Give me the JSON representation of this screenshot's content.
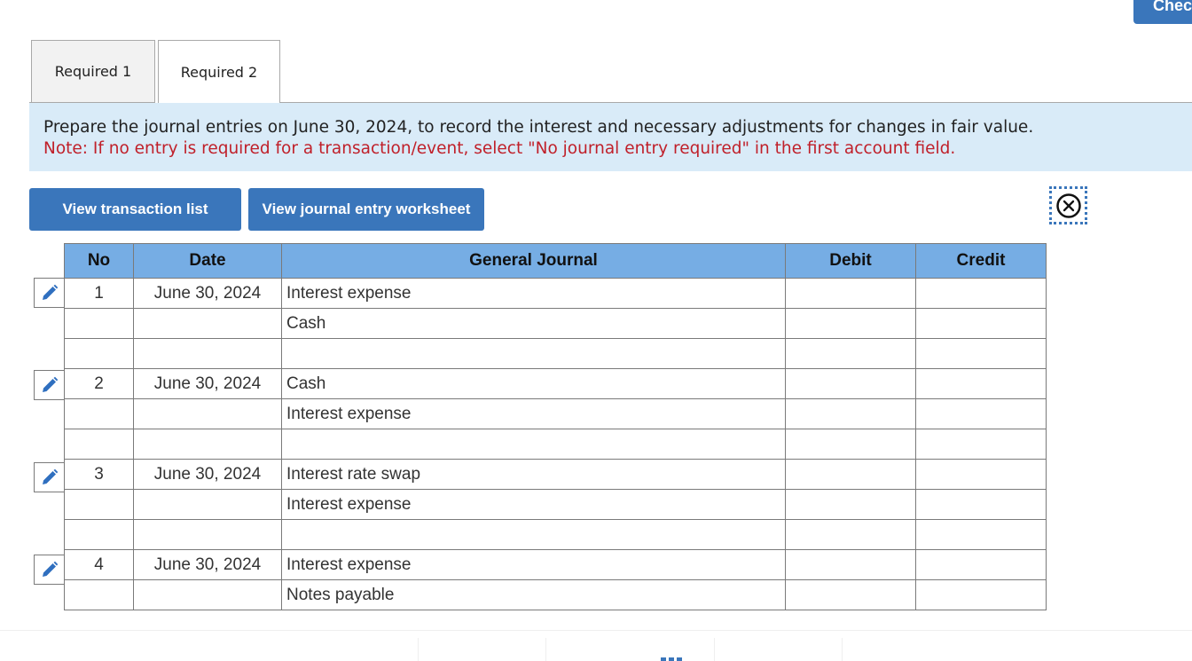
{
  "header": {
    "check_label": "Check"
  },
  "tabs": [
    {
      "label": "Required 1",
      "active": false
    },
    {
      "label": "Required 2",
      "active": true
    }
  ],
  "instructions": {
    "main": "Prepare the journal entries on June 30, 2024, to record the interest and necessary adjustments for changes in fair value.",
    "note": "Note: If no entry is required for a transaction/event, select \"No journal entry required\" in the first account field."
  },
  "buttons": {
    "view_transaction_list": "View transaction list",
    "view_journal_entry_worksheet": "View journal entry worksheet"
  },
  "table": {
    "headers": {
      "no": "No",
      "date": "Date",
      "general_journal": "General Journal",
      "debit": "Debit",
      "credit": "Credit"
    },
    "rows": [
      {
        "no": "1",
        "date": "June 30, 2024",
        "account": "Interest expense",
        "debit": "",
        "credit": ""
      },
      {
        "no": "",
        "date": "",
        "account": "Cash",
        "debit": "",
        "credit": ""
      },
      {
        "no": "",
        "date": "",
        "account": "",
        "debit": "",
        "credit": ""
      },
      {
        "no": "2",
        "date": "June 30, 2024",
        "account": "Cash",
        "debit": "",
        "credit": ""
      },
      {
        "no": "",
        "date": "",
        "account": "Interest expense",
        "debit": "",
        "credit": ""
      },
      {
        "no": "",
        "date": "",
        "account": "",
        "debit": "",
        "credit": ""
      },
      {
        "no": "3",
        "date": "June 30, 2024",
        "account": "Interest rate swap",
        "debit": "",
        "credit": ""
      },
      {
        "no": "",
        "date": "",
        "account": "Interest expense",
        "debit": "",
        "credit": ""
      },
      {
        "no": "",
        "date": "",
        "account": "",
        "debit": "",
        "credit": ""
      },
      {
        "no": "4",
        "date": "June 30, 2024",
        "account": "Interest expense",
        "debit": "",
        "credit": ""
      },
      {
        "no": "",
        "date": "",
        "account": "Notes payable",
        "debit": "",
        "credit": ""
      }
    ]
  },
  "colors": {
    "accent": "#3a76bb",
    "header_bg": "#76ade4",
    "instructions_bg": "#d9ebf8",
    "note_red": "#c0202a"
  }
}
